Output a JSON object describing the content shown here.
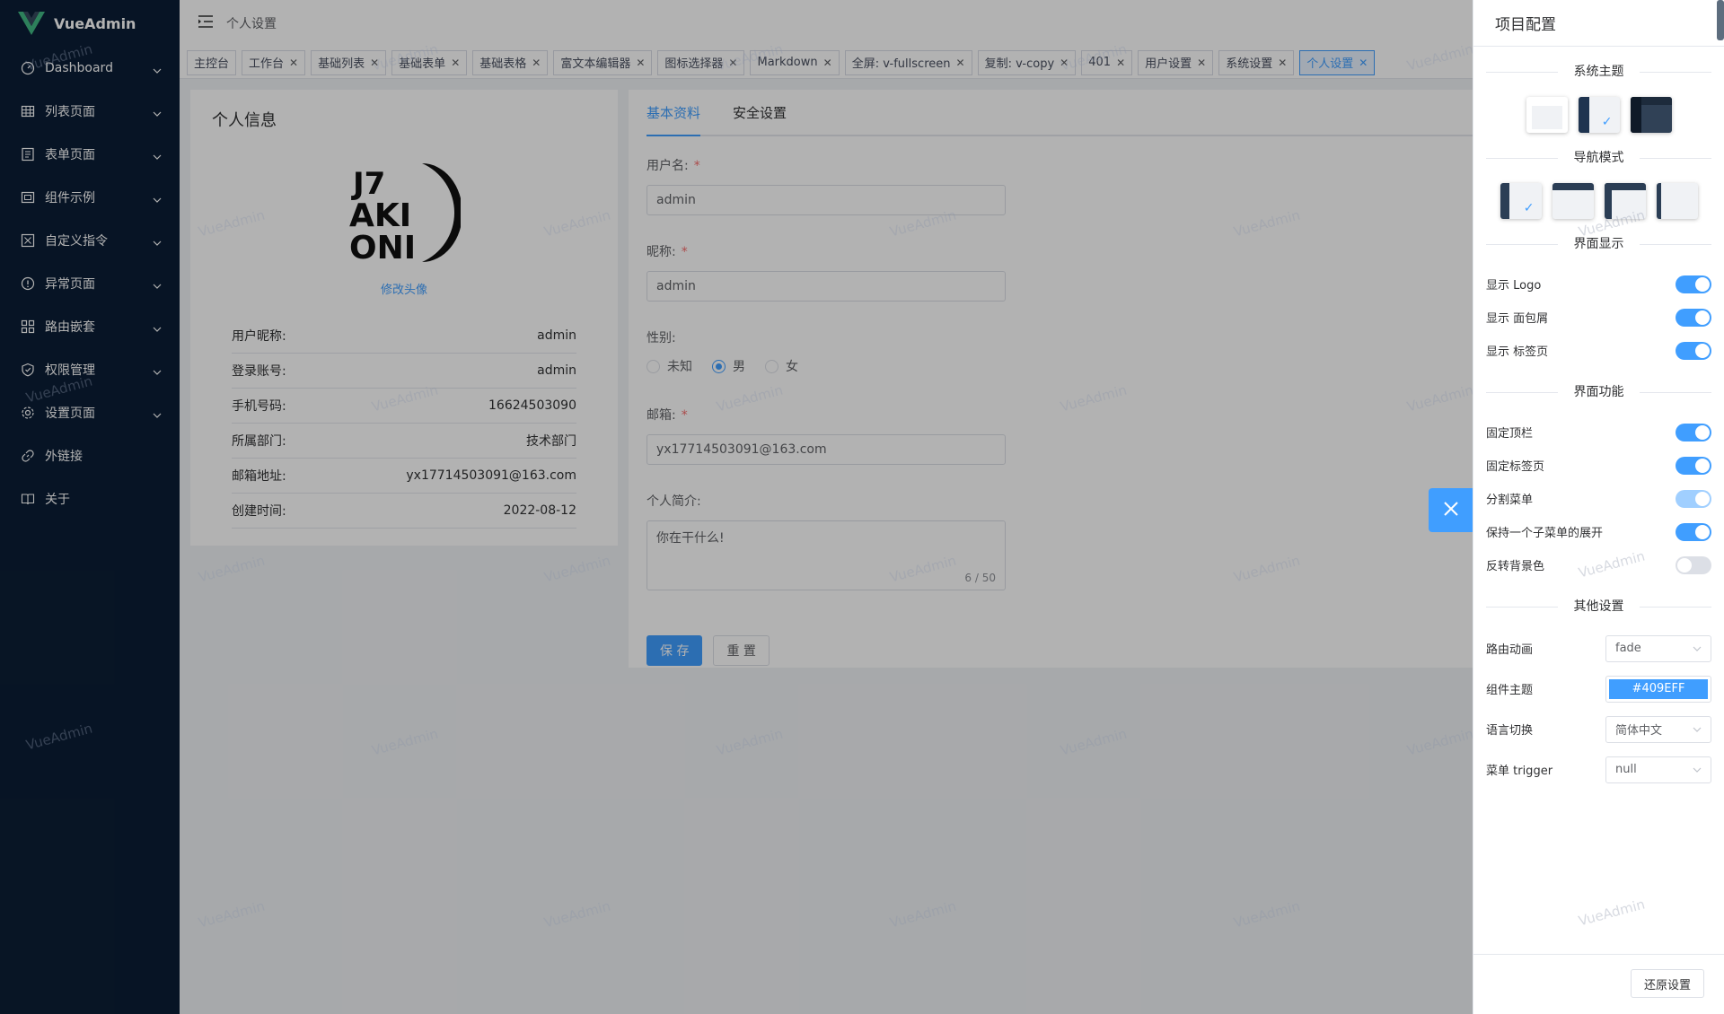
{
  "app": {
    "title": "VueAdmin"
  },
  "sidebar": {
    "items": [
      {
        "label": "Dashboard",
        "icon": "dashboard-icon"
      },
      {
        "label": "列表页面",
        "icon": "table-icon"
      },
      {
        "label": "表单页面",
        "icon": "form-icon"
      },
      {
        "label": "组件示例",
        "icon": "component-icon"
      },
      {
        "label": "自定义指令",
        "icon": "directive-icon"
      },
      {
        "label": "异常页面",
        "icon": "warning-icon"
      },
      {
        "label": "路由嵌套",
        "icon": "nested-icon"
      },
      {
        "label": "权限管理",
        "icon": "shield-icon"
      },
      {
        "label": "设置页面",
        "icon": "gear-icon"
      },
      {
        "label": "外链接",
        "icon": "link-icon"
      },
      {
        "label": "关于",
        "icon": "book-icon"
      }
    ]
  },
  "navbar": {
    "breadcrumb": "个人设置"
  },
  "tags": [
    {
      "label": "主控台"
    },
    {
      "label": "工作台"
    },
    {
      "label": "基础列表"
    },
    {
      "label": "基础表单"
    },
    {
      "label": "基础表格"
    },
    {
      "label": "富文本编辑器"
    },
    {
      "label": "图标选择器"
    },
    {
      "label": "Markdown"
    },
    {
      "label": "全屏: v-fullscreen"
    },
    {
      "label": "复制: v-copy"
    },
    {
      "label": "401"
    },
    {
      "label": "用户设置"
    },
    {
      "label": "系统设置"
    },
    {
      "label": "个人设置"
    }
  ],
  "profile": {
    "title": "个人信息",
    "change_avatar": "修改头像",
    "rows": [
      {
        "label": "用户昵称:",
        "value": "admin"
      },
      {
        "label": "登录账号:",
        "value": "admin"
      },
      {
        "label": "手机号码:",
        "value": "16624503090"
      },
      {
        "label": "所属部门:",
        "value": "技术部门"
      },
      {
        "label": "邮箱地址:",
        "value": "yx17714503091@163.com"
      },
      {
        "label": "创建时间:",
        "value": "2022-08-12"
      }
    ]
  },
  "form": {
    "tabs": [
      "基本资料",
      "安全设置"
    ],
    "username_label": "用户名:",
    "username": "admin",
    "nickname_label": "昵称:",
    "nickname": "admin",
    "gender_label": "性别:",
    "gender_options": [
      "未知",
      "男",
      "女"
    ],
    "gender_selected": "男",
    "email_label": "邮箱:",
    "email": "yx17714503091@163.com",
    "bio_label": "个人简介:",
    "bio": "你在干什么!",
    "bio_count": "6 / 50",
    "save": "保 存",
    "reset": "重 置"
  },
  "watermark": "VueAdmin",
  "drawer": {
    "title": "项目配置",
    "section_theme": "系统主题",
    "section_nav": "导航模式",
    "section_display": "界面显示",
    "section_function": "界面功能",
    "section_other": "其他设置",
    "display_toggles": [
      {
        "label": "显示 Logo",
        "on": true
      },
      {
        "label": "显示 面包屑",
        "on": true
      },
      {
        "label": "显示 标签页",
        "on": true
      }
    ],
    "function_toggles": [
      {
        "label": "固定顶栏",
        "on": true
      },
      {
        "label": "固定标签页",
        "on": true
      },
      {
        "label": "分割菜单",
        "on": true
      },
      {
        "label": "保持一个子菜单的展开",
        "on": true
      },
      {
        "label": "反转背景色",
        "on": false
      }
    ],
    "route_anim_label": "路由动画",
    "route_anim": "fade",
    "component_theme_label": "组件主题",
    "component_theme": "#409EFF",
    "language_label": "语言切换",
    "language": "简体中文",
    "menu_trigger_label": "菜单 trigger",
    "menu_trigger": "null",
    "reset_button": "还原设置"
  },
  "colors": {
    "accent": "#409eff",
    "sidebar": "#0b1e35"
  }
}
